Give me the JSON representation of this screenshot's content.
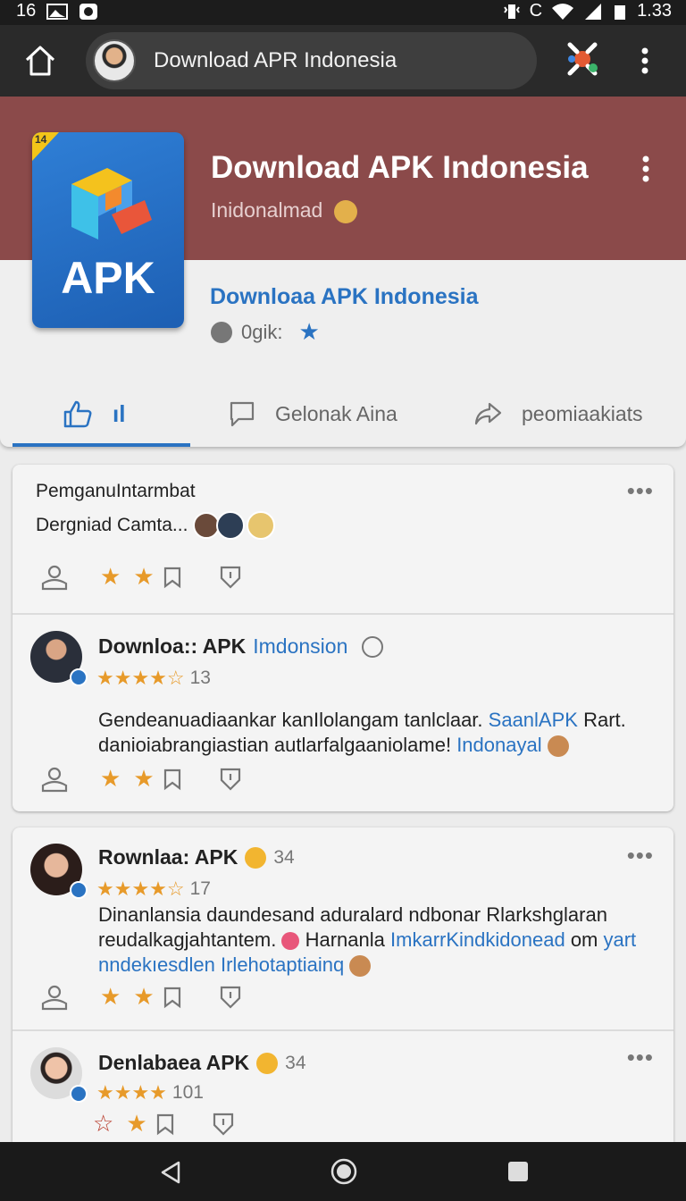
{
  "status_bar": {
    "left_text": "16",
    "right_text": "C",
    "time": "1.33"
  },
  "toolbar": {
    "url_title": "Download APR Indonesia"
  },
  "hero": {
    "title": "Download APK Indonesia",
    "subtitle": "Inidonalmad",
    "link": "Downloaa APK Indonesia",
    "meta": "0gik:",
    "icon_label": "APK",
    "icon_tag": "14"
  },
  "tabs": [
    {
      "label": "ıl"
    },
    {
      "label": "Gelonak Aina"
    },
    {
      "label": "peomiaakiats"
    }
  ],
  "posts": [
    {
      "line1": "PemganuIntarmbat",
      "line2": "Dergniad Camta..."
    },
    {
      "name": "Downloa:: APK",
      "name_blue": "Imdonsion",
      "rating": "★★★★☆",
      "count": "13",
      "body": "Gendeanuadiaankar kanIlolangam tanlclaar.",
      "body_blue": "SaanlAPK",
      "body2": "Rart. danioiabrangiastian autlarfalgaaniolame!",
      "body_blue2": "Indonayal"
    },
    {
      "name": "Rownlaa: APK",
      "extra": "34",
      "rating": "★★★★☆",
      "count": "17",
      "body": "Dinanlansia daundesand aduralard ndbonar Rlarkshglaran reudalkagjahtantem.",
      "body_mid": "Harnanla",
      "body_blue": "ImkarrKindkidonead",
      "body_tail": "om",
      "body_blue2": "yart nndekıesdlen Irlehotaptiainq"
    },
    {
      "name": "Denlabaea APK",
      "extra": "34",
      "rating": "★★★★",
      "count": "101"
    }
  ],
  "icons": {
    "home": "home-icon",
    "menu": "more-vert-icon",
    "like": "thumbs-up-icon",
    "comment": "comment-icon",
    "share": "share-icon"
  },
  "colors": {
    "accent": "#2a73c2",
    "band": "#8b4a4a",
    "star": "#e79a2a"
  }
}
